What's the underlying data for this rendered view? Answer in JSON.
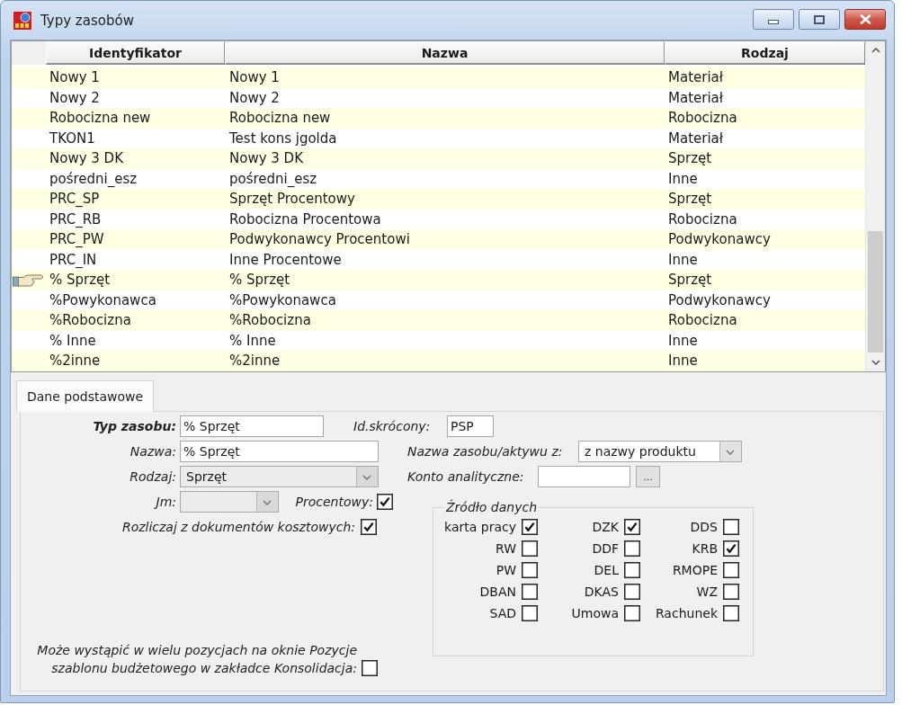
{
  "window": {
    "title": "Typy zasobów"
  },
  "table": {
    "columns": [
      "Identyfikator",
      "Nazwa",
      "Rodzaj"
    ],
    "rows": [
      {
        "cells": [
          "Nowy 1",
          "Nowy 1",
          "Materiał"
        ],
        "selected": false
      },
      {
        "cells": [
          "Nowy 2",
          "Nowy 2",
          "Materiał"
        ],
        "selected": false
      },
      {
        "cells": [
          "Robocizna new",
          "Robocizna new",
          "Robocizna"
        ],
        "selected": false
      },
      {
        "cells": [
          "TKON1",
          "Test kons jgolda",
          "Materiał"
        ],
        "selected": false
      },
      {
        "cells": [
          "Nowy 3 DK",
          "Nowy 3 DK",
          "Sprzęt"
        ],
        "selected": false
      },
      {
        "cells": [
          "pośredni_esz",
          "pośredni_esz",
          "Inne"
        ],
        "selected": false
      },
      {
        "cells": [
          "PRC_SP",
          "Sprzęt Procentowy",
          "Sprzęt"
        ],
        "selected": false
      },
      {
        "cells": [
          "PRC_RB",
          "Robocizna Procentowa",
          "Robocizna"
        ],
        "selected": false
      },
      {
        "cells": [
          "PRC_PW",
          "Podwykonawcy Procentowi",
          "Podwykonawcy"
        ],
        "selected": false
      },
      {
        "cells": [
          "PRC_IN",
          "Inne Procentowe",
          "Inne"
        ],
        "selected": false
      },
      {
        "cells": [
          "% Sprzęt",
          "% Sprzęt",
          "Sprzęt"
        ],
        "selected": true
      },
      {
        "cells": [
          "%Powykonawca",
          "%Powykonawca",
          "Podwykonawcy"
        ],
        "selected": false
      },
      {
        "cells": [
          "%Robocizna",
          "%Robocizna",
          "Robocizna"
        ],
        "selected": false
      },
      {
        "cells": [
          "% Inne",
          "% Inne",
          "Inne"
        ],
        "selected": false
      },
      {
        "cells": [
          "%2inne",
          "%2inne",
          "Inne"
        ],
        "selected": false
      }
    ]
  },
  "tabs": [
    {
      "label": "Dane podstawowe",
      "selected": true
    }
  ],
  "form": {
    "resource_type": {
      "label": "Typ zasobu:",
      "value": "% Sprzęt",
      "bold": true
    },
    "short_id": {
      "label": "Id.skrócony:",
      "value": "PSP",
      "bold": false
    },
    "name": {
      "label": "Nazwa:",
      "value": "% Sprzęt",
      "bold": false
    },
    "name_source": {
      "label": "Nazwa zasobu/aktywu z:",
      "value": "z nazwy produktu",
      "disabled": false,
      "bold": false
    },
    "kind": {
      "label": "Rodzaj:",
      "value": "Sprzęt",
      "disabled": true,
      "bold": false
    },
    "analytic_account": {
      "label": "Konto analityczne:",
      "button": "...",
      "bold": false
    },
    "unit": {
      "label": "Jm:",
      "disabled": true,
      "bold": false
    },
    "percentage": {
      "label": "Procentowy:",
      "checked": true,
      "bold": false
    },
    "settle_from_cost_docs": {
      "label": "Rozliczaj z dokumentów kosztowych:",
      "checked": true,
      "bold": false
    },
    "data_source": {
      "title": "Źródło danych",
      "items": [
        {
          "label": "karta pracy",
          "checked": true
        },
        {
          "label": "DZK",
          "checked": true
        },
        {
          "label": "DDS",
          "checked": false
        },
        {
          "label": "RW",
          "checked": false
        },
        {
          "label": "DDF",
          "checked": false
        },
        {
          "label": "KRB",
          "checked": true
        },
        {
          "label": "PW",
          "checked": false
        },
        {
          "label": "DEL",
          "checked": false
        },
        {
          "label": "RMOPE",
          "checked": false
        },
        {
          "label": "DBAN",
          "checked": false
        },
        {
          "label": "DKAS",
          "checked": false
        },
        {
          "label": "WZ",
          "checked": false
        },
        {
          "label": "SAD",
          "checked": false
        },
        {
          "label": "Umowa",
          "checked": false
        },
        {
          "label": "Rachunek",
          "checked": false
        }
      ]
    },
    "consolidation": {
      "label": "Może wystąpić w wielu pozycjach na oknie Pozycje szablonu budżetowego w zakładce Konsolidacja:",
      "checked": false,
      "bold": false
    }
  }
}
